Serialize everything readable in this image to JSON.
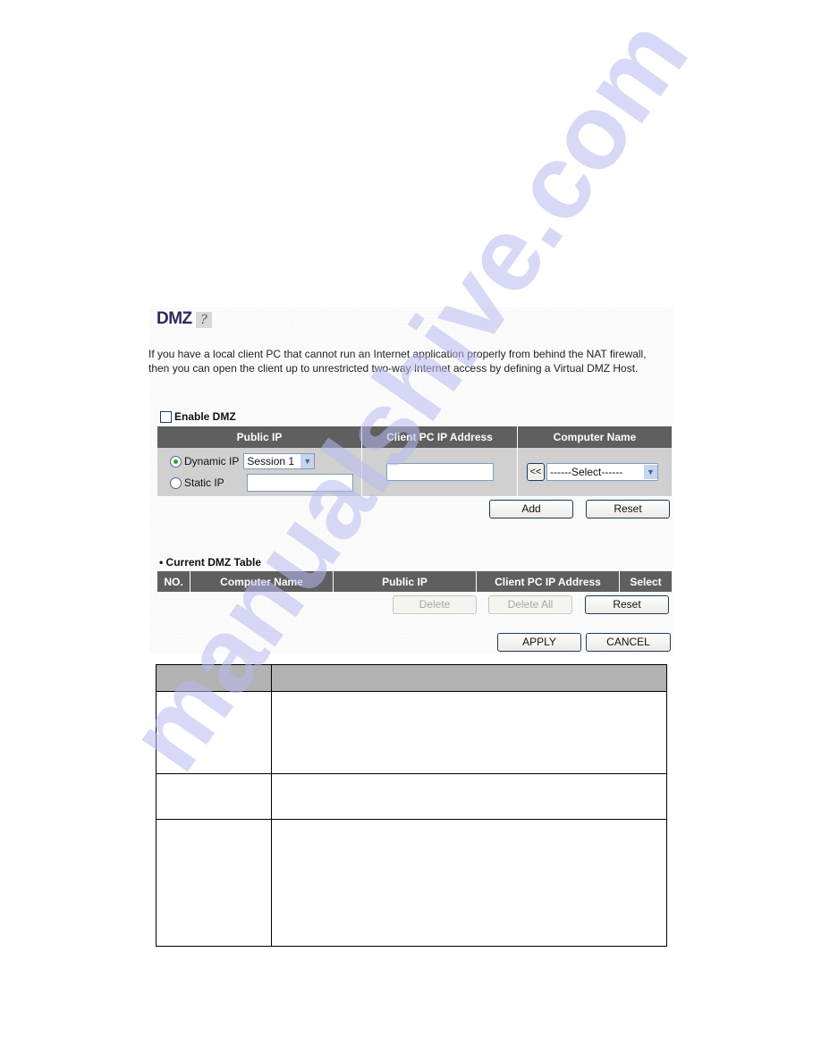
{
  "dmz_page": {
    "title": "DMZ",
    "help_icon": "help-question-icon",
    "description": "If you have a local client PC that cannot run an Internet application properly from behind the NAT firewall, then you can open the client up to unrestricted two-way Internet access by defining a Virtual DMZ Host.",
    "enable_label": "Enable DMZ",
    "enable_checked": false,
    "config_table": {
      "headers": [
        "Public IP",
        "Client PC IP Address",
        "Computer Name"
      ],
      "dynamic_ip_label": "Dynamic IP",
      "dynamic_ip_selected": true,
      "session_value": "Session 1",
      "static_ip_label": "Static IP",
      "static_ip_value": "",
      "client_ip_value": "",
      "copy_button_label": "<<",
      "computer_select_value": "------Select------"
    },
    "add_label": "Add",
    "reset_label": "Reset",
    "current_table": {
      "title": "Current DMZ Table",
      "headers": [
        "NO.",
        "Computer Name",
        "Public IP",
        "Client PC IP Address",
        "Select"
      ],
      "rows": []
    },
    "delete_label": "Delete",
    "delete_all_label": "Delete All",
    "reset2_label": "Reset",
    "apply_label": "APPLY",
    "cancel_label": "CANCEL"
  },
  "description_table": {
    "rows": [
      [
        "",
        ""
      ],
      [
        "",
        ""
      ],
      [
        "",
        ""
      ],
      [
        "",
        ""
      ]
    ]
  },
  "watermark": {
    "text": "manualshive.com",
    "color": "#c8c8f4"
  }
}
